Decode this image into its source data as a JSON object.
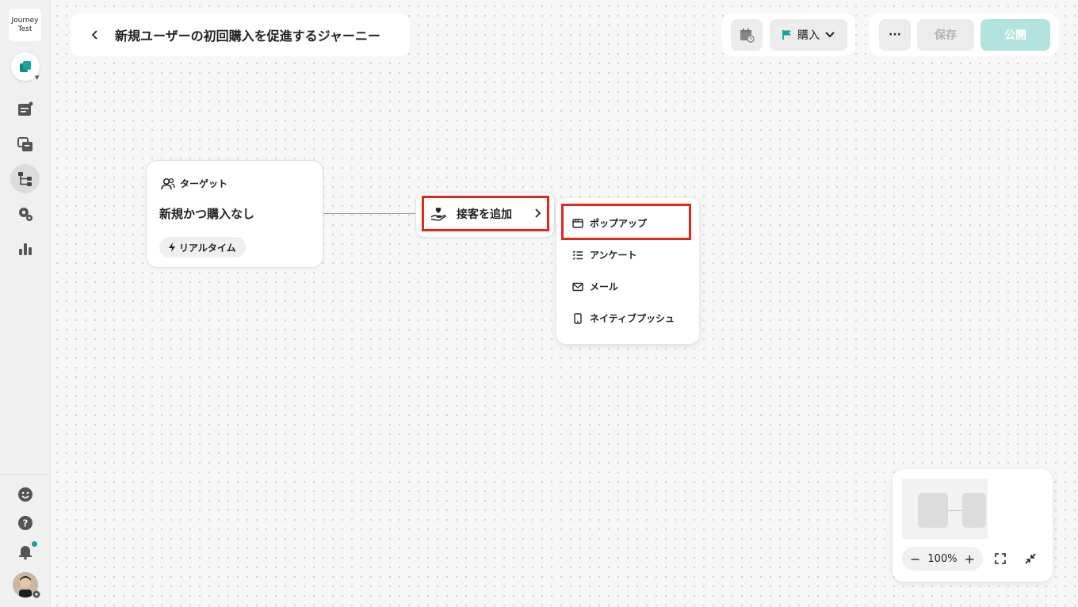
{
  "sidebar": {
    "logo_line1": "Journey",
    "logo_line2": "Test",
    "items": [
      {
        "name": "app-switcher-icon"
      },
      {
        "name": "campaign-list-icon"
      },
      {
        "name": "template-icon"
      },
      {
        "name": "journey-icon",
        "active": true
      },
      {
        "name": "settings-icon"
      },
      {
        "name": "analytics-icon"
      }
    ],
    "bottom_items": [
      "support-chat-icon",
      "help-icon",
      "bell-icon",
      "avatar"
    ]
  },
  "header": {
    "back_label": "‹",
    "title": "新規ユーザーの初回購入を促進するジャーニー",
    "goal_label": "購入",
    "more_label": "···",
    "save_label": "保存",
    "publish_label": "公開"
  },
  "target_node": {
    "header": "ターゲット",
    "segment": "新規かつ購入なし",
    "badge": "リアルタイム"
  },
  "add_node": {
    "label": "接客を追加"
  },
  "menu": {
    "items": [
      {
        "label": "ポップアップ",
        "icon": "popup-icon"
      },
      {
        "label": "アンケート",
        "icon": "survey-icon"
      },
      {
        "label": "メール",
        "icon": "mail-icon"
      },
      {
        "label": "ネイティブプッシュ",
        "icon": "mobile-icon"
      }
    ]
  },
  "minimap": {
    "zoom_label": "100%",
    "zoom_out": "−",
    "zoom_in": "+"
  },
  "colors": {
    "accent": "#12a39b",
    "highlight": "#e8251b",
    "publish_disabled": "#b3e3df"
  }
}
